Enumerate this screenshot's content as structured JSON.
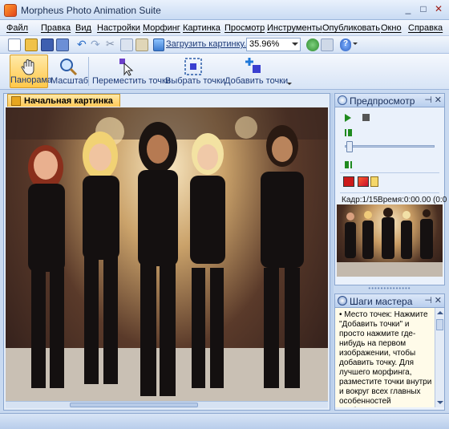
{
  "window": {
    "title": "Morpheus Photo Animation Suite",
    "minimize": "_",
    "maximize": "□",
    "close": "✕"
  },
  "menu": [
    "Файл",
    "Правка",
    "Вид",
    "Настройки",
    "Морфинг",
    "Картинка",
    "Просмотр",
    "Инструменты",
    "Опубликовать",
    "Окно",
    "Справка"
  ],
  "toolbar": {
    "load_label": "Загрузить картинку...",
    "zoom": "35.96%",
    "help_glyph": "?"
  },
  "tools": [
    {
      "label": "Панорама",
      "icon": "hand-icon",
      "active": true
    },
    {
      "label": "Масштаб",
      "icon": "magnifier-icon",
      "active": false
    },
    {
      "label": "Переместить точки",
      "icon": "move-points-icon",
      "active": false
    },
    {
      "label": "Выбрать точки",
      "icon": "select-points-icon",
      "active": false
    },
    {
      "label": "Добавить точки",
      "icon": "add-points-icon",
      "active": false
    }
  ],
  "main_tab": {
    "label": "Начальная картинка"
  },
  "preview": {
    "title": "Предпросмотр",
    "frame_text": "Кадр:1/15Время:0:00.00 (0:0",
    "slider_value": 0,
    "color_start": "#cc1a1a",
    "color_end": "#c8102e"
  },
  "wizard": {
    "title": "Шаги мастера",
    "text": "• Место точек: Нажмите \"Добавить точки\" и просто нажмите где-нибудь на первом изображении, чтобы добавить точку.  Для лучшего морфинга, разместите точки внутри и вокруг всех главных особенностей изображения.  Если это"
  },
  "panel_pin": "⊣",
  "panel_close": "✕"
}
